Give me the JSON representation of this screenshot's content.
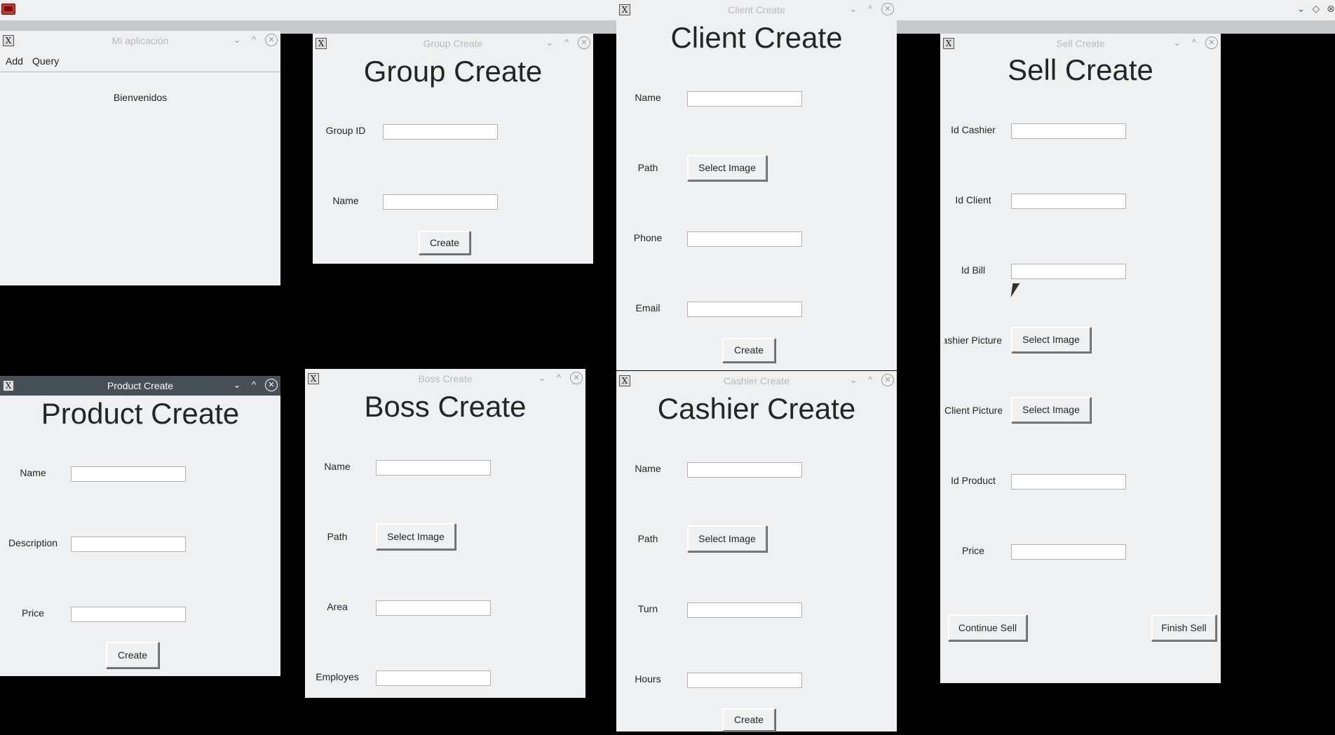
{
  "desktop": {
    "accent": "#475057"
  },
  "main_window": {
    "title": "Mi aplicación",
    "menu_add": "Add",
    "menu_query": "Query",
    "welcome": "Bienvenidos"
  },
  "group_create": {
    "title": "Group Create",
    "heading": "Group Create",
    "group_id_label": "Group ID",
    "name_label": "Name",
    "create": "Create"
  },
  "client_create": {
    "title": "Client Create",
    "heading": "Client Create",
    "name_label": "Name",
    "path_label": "Path",
    "select_image": "Select Image",
    "phone_label": "Phone",
    "email_label": "Email",
    "create": "Create"
  },
  "sell_create": {
    "title": "Sell Create",
    "heading": "Sell Create",
    "id_cashier_label": "Id Cashier",
    "id_client_label": "Id Client",
    "id_bill_label": "Id Bill",
    "cashier_picture_label": "Cashier Picture",
    "client_picture_label": "Client Picture",
    "select_image_1": "Select Image",
    "select_image_2": "Select Image",
    "id_product_label": "Id Product",
    "price_label": "Price",
    "continue_sell": "Continue Sell",
    "finish_sell": "Finish Sell"
  },
  "product_create": {
    "title": "Product Create",
    "heading": "Product Create",
    "name_label": "Name",
    "description_label": "Description",
    "price_label": "Price",
    "create": "Create"
  },
  "boss_create": {
    "title": "Boss Create",
    "heading": "Boss Create",
    "name_label": "Name",
    "path_label": "Path",
    "select_image": "Select Image",
    "area_label": "Area",
    "employes_label": "Employes"
  },
  "cashier_create": {
    "title": "Cashier Create",
    "heading": "Cashier Create",
    "name_label": "Name",
    "path_label": "Path",
    "select_image": "Select Image",
    "turn_label": "Turn",
    "hours_label": "Hours",
    "create": "Create"
  }
}
